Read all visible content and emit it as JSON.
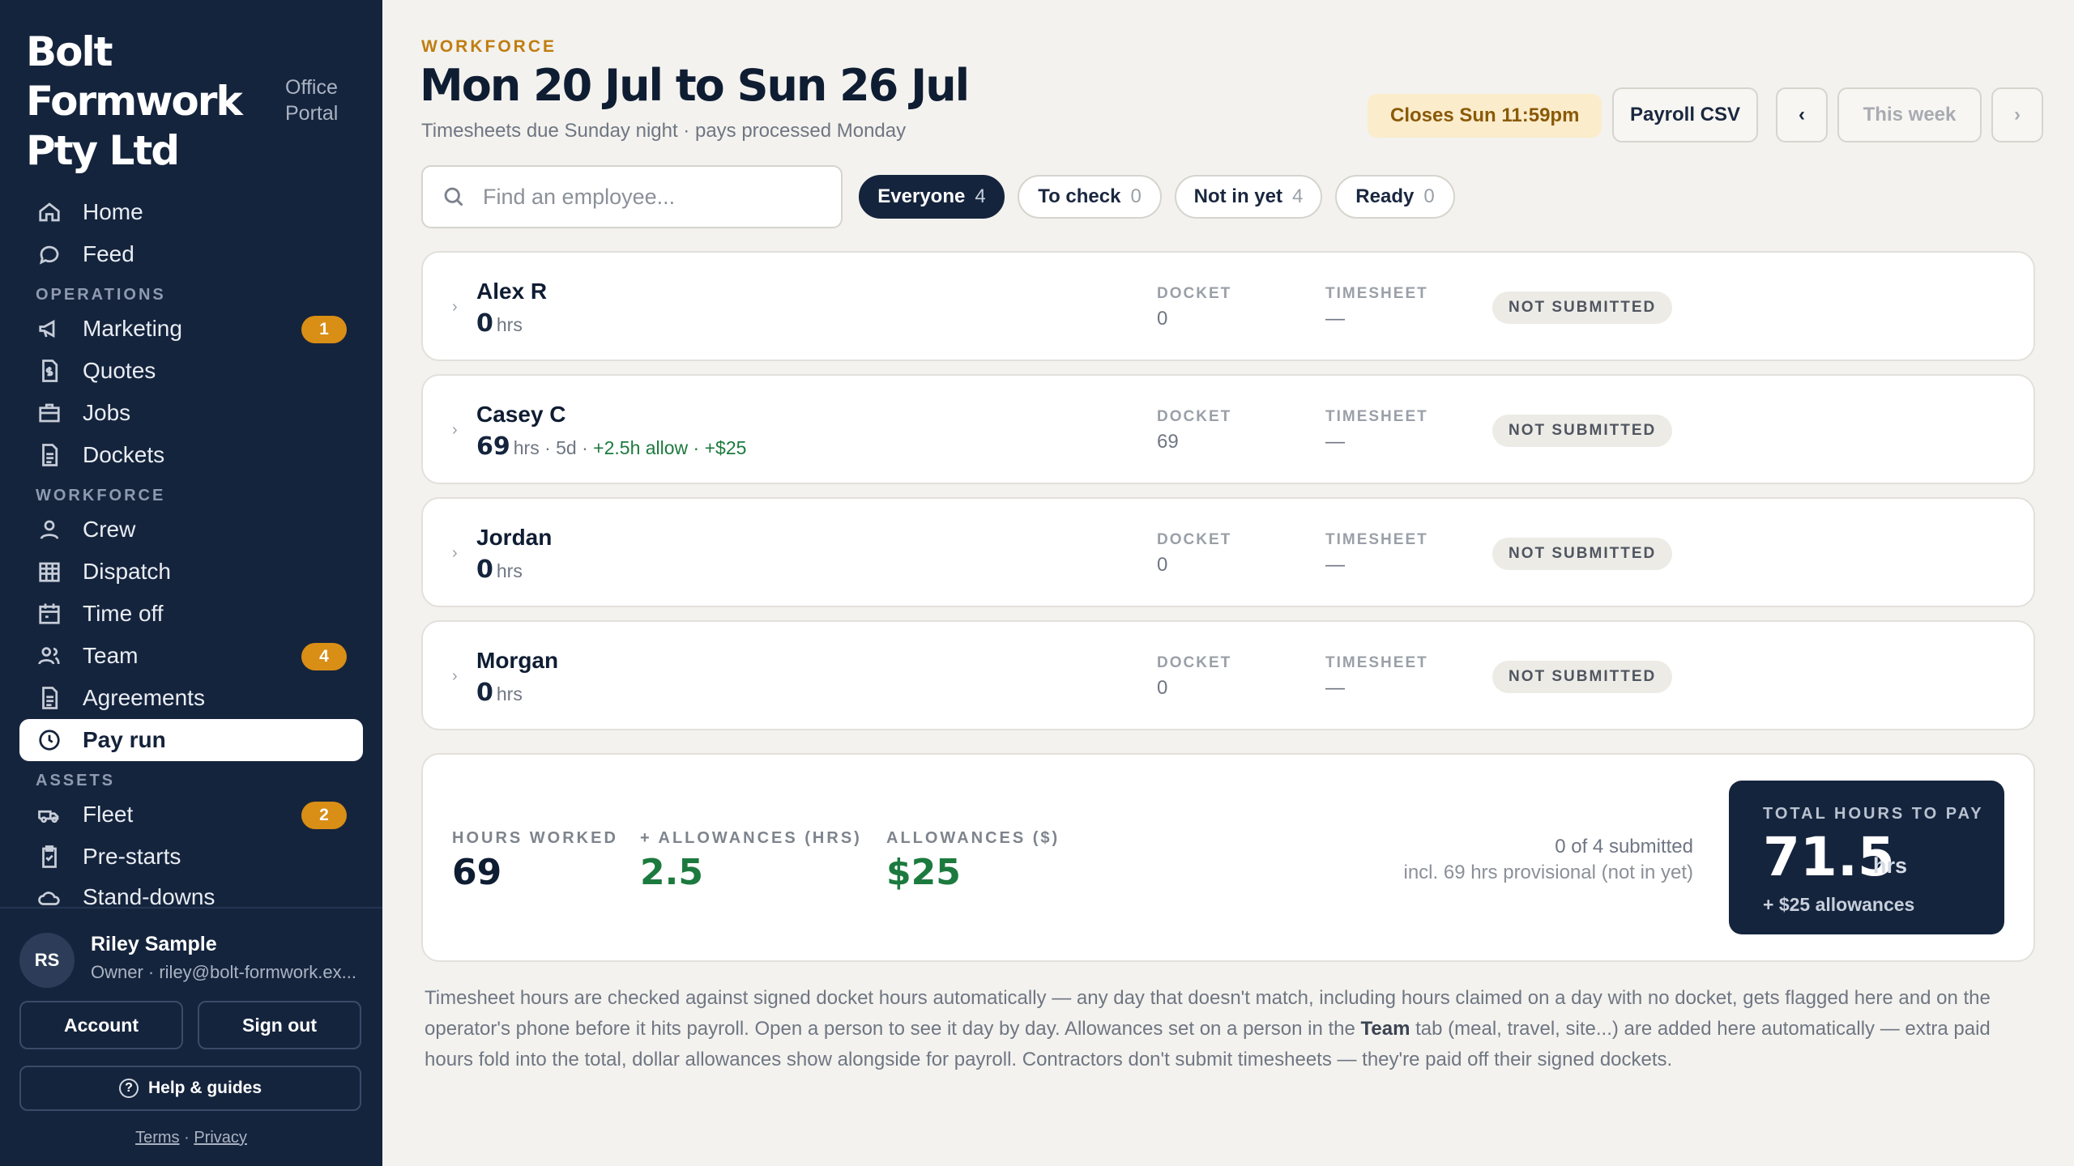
{
  "brand": {
    "name": "Bolt Formwork Pty Ltd",
    "portal": "Office Portal"
  },
  "nav": {
    "home": "Home",
    "feed": "Feed",
    "section_operations": "OPERATIONS",
    "marketing": "Marketing",
    "marketing_badge": "1",
    "quotes": "Quotes",
    "jobs": "Jobs",
    "dockets": "Dockets",
    "section_workforce": "WORKFORCE",
    "crew": "Crew",
    "dispatch": "Dispatch",
    "time_off": "Time off",
    "team": "Team",
    "team_badge": "4",
    "agreements": "Agreements",
    "pay_run": "Pay run",
    "section_assets": "ASSETS",
    "fleet": "Fleet",
    "fleet_badge": "2",
    "pre_starts": "Pre-starts",
    "stand_downs": "Stand-downs"
  },
  "user": {
    "initials": "RS",
    "name": "Riley Sample",
    "role_email": "Owner · riley@bolt-formwork.ex..."
  },
  "footer": {
    "account": "Account",
    "sign_out": "Sign out",
    "help": "Help & guides",
    "terms": "Terms",
    "separator": "·",
    "privacy": "Privacy"
  },
  "header": {
    "eyebrow": "WORKFORCE",
    "title": "Mon 20 Jul to Sun 26 Jul",
    "subtitle": "Timesheets due Sunday night · pays processed Monday",
    "closes": "Closes Sun 11:59pm",
    "payroll_csv": "Payroll CSV",
    "prev": "‹",
    "this_week": "This week",
    "next": "›"
  },
  "search": {
    "placeholder": "Find an employee..."
  },
  "filters": [
    {
      "label": "Everyone",
      "count": "4"
    },
    {
      "label": "To check",
      "count": "0"
    },
    {
      "label": "Not in yet",
      "count": "4"
    },
    {
      "label": "Ready",
      "count": "0"
    }
  ],
  "columns": {
    "docket": "DOCKET",
    "timesheet": "TIMESHEET"
  },
  "employees": [
    {
      "name": "Alex R",
      "hours": "0",
      "unit": "hrs",
      "extra": "",
      "allow": "",
      "docket": "0",
      "timesheet": "—",
      "status": "NOT SUBMITTED"
    },
    {
      "name": "Casey C",
      "hours": "69",
      "unit": "hrs",
      "extra": " · 5d · ",
      "allow": "+2.5h allow · +$25",
      "docket": "69",
      "timesheet": "—",
      "status": "NOT SUBMITTED"
    },
    {
      "name": "Jordan",
      "hours": "0",
      "unit": "hrs",
      "extra": "",
      "allow": "",
      "docket": "0",
      "timesheet": "—",
      "status": "NOT SUBMITTED"
    },
    {
      "name": "Morgan",
      "hours": "0",
      "unit": "hrs",
      "extra": "",
      "allow": "",
      "docket": "0",
      "timesheet": "—",
      "status": "NOT SUBMITTED"
    }
  ],
  "summary": {
    "hours_worked_label": "HOURS WORKED",
    "hours_worked": "69",
    "allow_hrs_label": "+ ALLOWANCES (HRS)",
    "allow_hrs": "2.5",
    "allow_dollars_label": "ALLOWANCES ($)",
    "allow_dollars": "$25",
    "submitted": "0 of 4 submitted",
    "provisional": "incl. 69 hrs provisional (not in yet)",
    "total_label": "TOTAL HOURS TO PAY",
    "total": "71.5",
    "total_unit": "hrs",
    "total_sub": "+ $25 allowances"
  },
  "footnote": {
    "part1": "Timesheet hours are checked against signed docket hours automatically — any day that doesn't match, including hours claimed on a day with no docket, gets flagged here and on the operator's phone before it hits payroll. Open a person to see it day by day. Allowances set on a person in the ",
    "bold": "Team",
    "part2": " tab (meal, travel, site...) are added here automatically — extra paid hours fold into the total, dollar allowances show alongside for payroll. Contractors don't submit timesheets — they're paid off their signed dockets."
  },
  "colors": {
    "sidebar": "#15243d",
    "accent": "#d98e15",
    "green": "#1c7a3e",
    "bg": "#f3f2ee"
  }
}
